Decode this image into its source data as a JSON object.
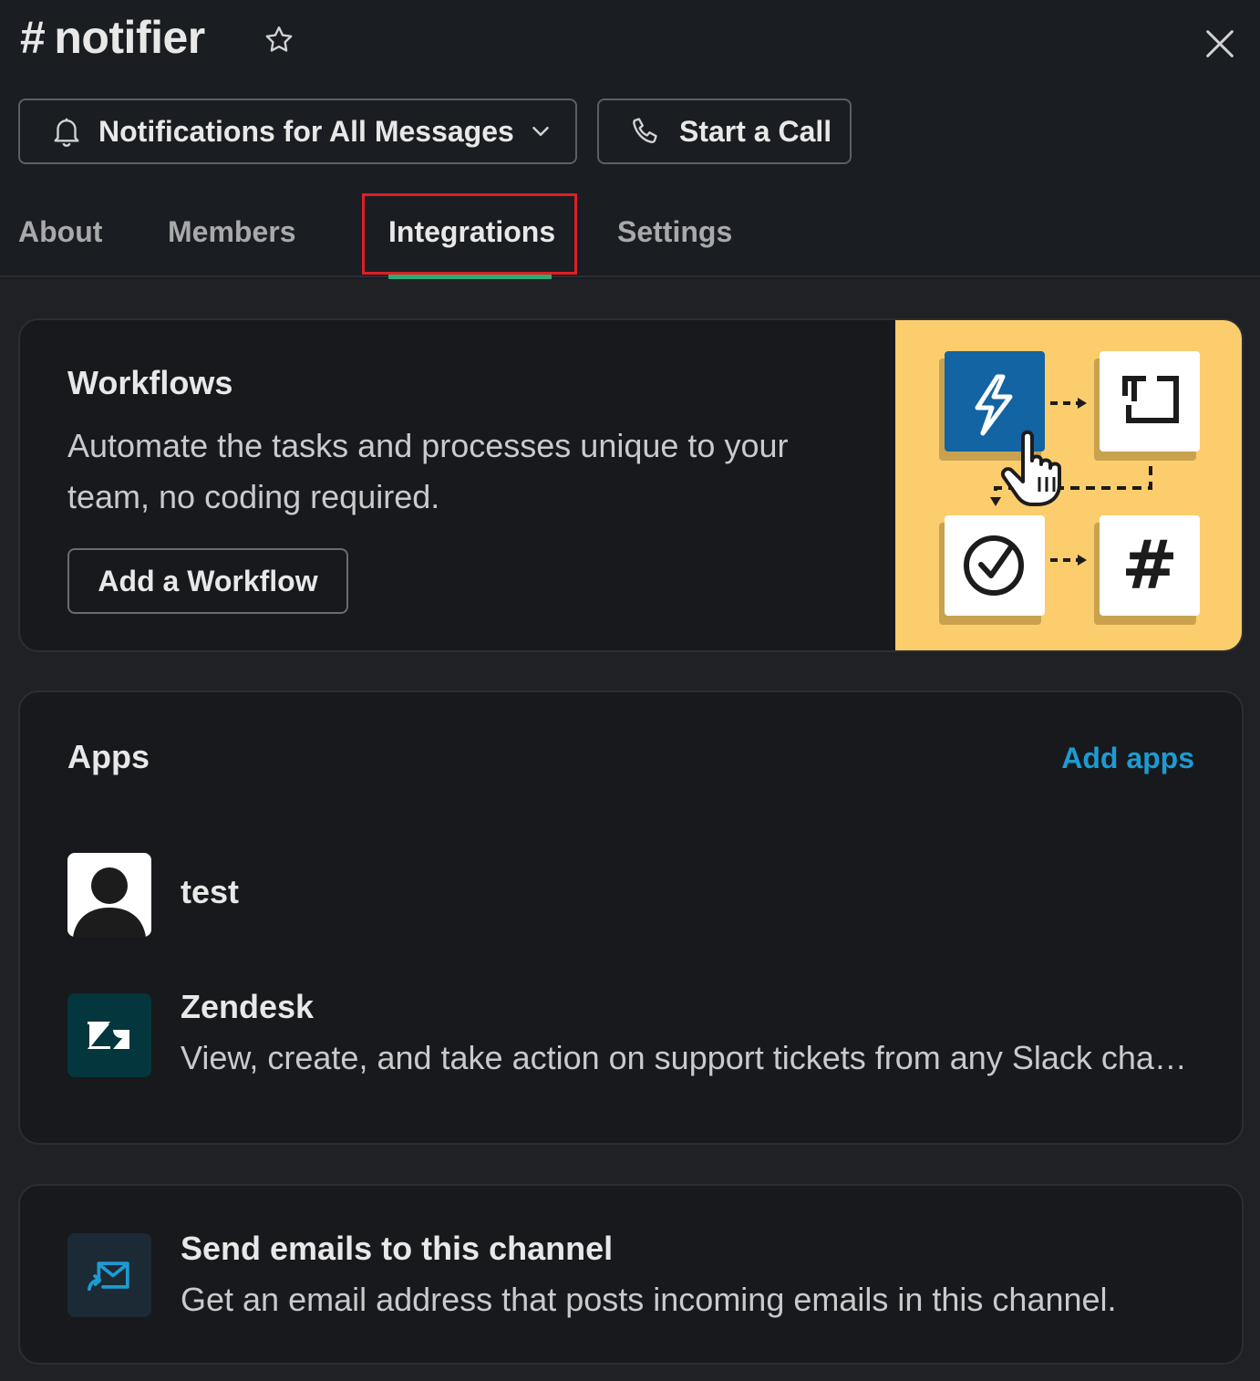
{
  "header": {
    "hash": "#",
    "channel_name": "notifier",
    "notifications_label": "Notifications for All Messages",
    "call_label": "Start a Call"
  },
  "tabs": [
    {
      "label": "About",
      "active": false
    },
    {
      "label": "Members",
      "active": false
    },
    {
      "label": "Integrations",
      "active": true
    },
    {
      "label": "Settings",
      "active": false
    }
  ],
  "workflows": {
    "title": "Workflows",
    "description": "Automate the tasks and processes unique to your team, no coding required.",
    "button_label": "Add a Workflow"
  },
  "apps": {
    "title": "Apps",
    "add_label": "Add apps",
    "items": [
      {
        "name": "test",
        "description": ""
      },
      {
        "name": "Zendesk",
        "description": "View, create, and take action on support tickets from any Slack channel."
      }
    ]
  },
  "email": {
    "title": "Send emails to this channel",
    "description": "Get an email address that posts incoming emails in this channel."
  },
  "colors": {
    "background": "#1a1d21",
    "accent_green": "#2bac76",
    "link_blue": "#1d9bd1",
    "highlight_red": "#e01e25",
    "illustration_yellow": "#fccd6c",
    "zendesk_bg": "#03363d"
  }
}
